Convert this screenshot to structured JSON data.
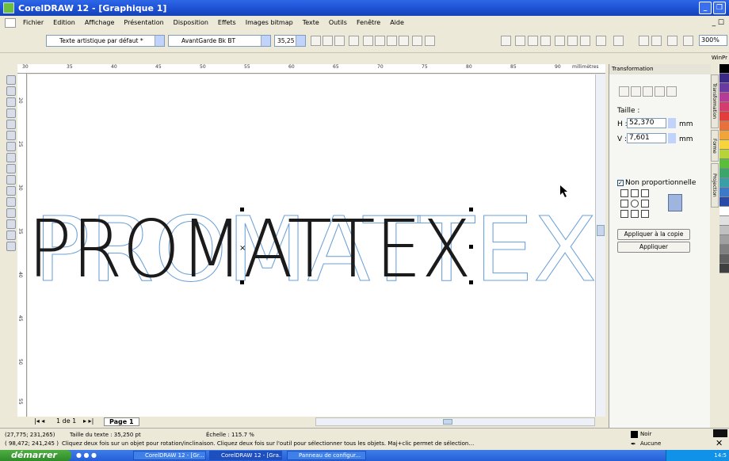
{
  "window": {
    "title": "CorelDRAW 12 - [Graphique 1]"
  },
  "menu": [
    "Fichier",
    "Edition",
    "Affichage",
    "Présentation",
    "Disposition",
    "Effets",
    "Images bitmap",
    "Texte",
    "Outils",
    "Fenêtre",
    "Aide"
  ],
  "propbar": {
    "text_style": "Texte artistique par défaut *",
    "font": "AvantGarde Bk BT",
    "size": "35,25",
    "zoom": "300%",
    "winpr": "WinPr"
  },
  "ruler": {
    "unit": "millimètres",
    "top_ticks": [
      "30",
      "35",
      "40",
      "45",
      "50",
      "55",
      "60",
      "65",
      "70",
      "75",
      "80",
      "85",
      "90"
    ],
    "left_ticks": [
      "20",
      "25",
      "30",
      "35",
      "40",
      "45",
      "50",
      "55"
    ]
  },
  "canvas": {
    "main_text": "PROMATTEX",
    "outline_text": "PROMATTEX",
    "outline_color": "#6aa0d8",
    "text_color": "#1b1b1b"
  },
  "pagebar": {
    "pages": "1 de 1",
    "tab": "Page 1"
  },
  "docker": {
    "title": "Transformation",
    "taille_label": "Taille :",
    "h_label": "H :",
    "h_value": "52,370",
    "v_label": "V :",
    "v_value": "7,601",
    "unit": "mm",
    "checkbox_label": "Non proportionnelle",
    "apply_copy": "Appliquer à la copie",
    "apply": "Appliquer",
    "tabs": [
      "Transformation",
      "Forme",
      "Projection"
    ]
  },
  "status": {
    "coords": "(27,775; 231,265)",
    "info": "Taille du texte : 35,250 pt",
    "scale": "Échelle : 115.7 %",
    "coords2": "( 98,472; 241,245 )",
    "hint": "Cliquez deux fois sur un objet pour rotation/inclinaison. Cliquez deux fois sur l'outil pour sélectionner tous les objets. Maj+clic permet de sélection…",
    "fill_label": "Noir",
    "outline_label": "Aucune"
  },
  "taskbar": {
    "start": "démarrer",
    "tasks": [
      "CorelDRAW 12 - [Gr...",
      "CorelDRAW 12 - [Gra...",
      "Panneau de configur..."
    ],
    "clock": "14:5"
  },
  "palette": [
    "#000000",
    "#3a2a85",
    "#6a3aa0",
    "#b43c96",
    "#d23c6e",
    "#e23c3c",
    "#e8703a",
    "#f0a43a",
    "#f6d43a",
    "#b6d43a",
    "#5abe3a",
    "#3aa66a",
    "#3a9ea6",
    "#3a7ac8",
    "#2a4aa8",
    "#ffffff",
    "#e0e0e0",
    "#c0c0c0",
    "#a0a0a0",
    "#808080",
    "#606060",
    "#404040"
  ]
}
